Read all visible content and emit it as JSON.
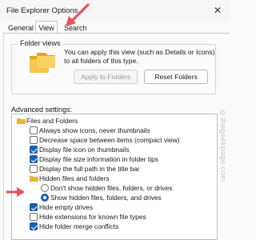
{
  "window": {
    "title": "File Explorer Options",
    "close_glyph": "✕"
  },
  "tabs": [
    {
      "label": "General",
      "selected": false
    },
    {
      "label": "View",
      "selected": true
    },
    {
      "label": "Search",
      "selected": false
    }
  ],
  "folder_views": {
    "title": "Folder views",
    "description": "You can apply this view (such as Details or Icons) to all folders of this type.",
    "apply_button": "Apply to Folders",
    "apply_enabled": false,
    "reset_button": "Reset Folders"
  },
  "advanced": {
    "label": "Advanced settings:",
    "items": [
      {
        "type": "folder",
        "label": "Files and Folders"
      },
      {
        "type": "checkbox",
        "checked": false,
        "label": "Always show icons, never thumbnails"
      },
      {
        "type": "checkbox",
        "checked": false,
        "label": "Decrease space between items (compact view)"
      },
      {
        "type": "checkbox",
        "checked": true,
        "label": "Display file icon on thumbnails"
      },
      {
        "type": "checkbox",
        "checked": true,
        "label": "Display file size information in folder tips"
      },
      {
        "type": "checkbox",
        "checked": false,
        "label": "Display the full path in the title bar"
      },
      {
        "type": "folder",
        "label": "Hidden files and folders"
      },
      {
        "type": "radio",
        "checked": false,
        "label": "Don't show hidden files, folders, or drives"
      },
      {
        "type": "radio",
        "checked": true,
        "label": "Show hidden files, folders, and drives"
      },
      {
        "type": "checkbox",
        "checked": true,
        "label": "Hide empty drives"
      },
      {
        "type": "checkbox",
        "checked": false,
        "label": "Hide extensions for known file types"
      },
      {
        "type": "checkbox",
        "checked": true,
        "label": "Hide folder merge conflicts"
      }
    ]
  },
  "watermark": "©thegeekpage.com",
  "colors": {
    "accent": "#1a5fb4",
    "annotation_arrow": "#e2535a"
  }
}
